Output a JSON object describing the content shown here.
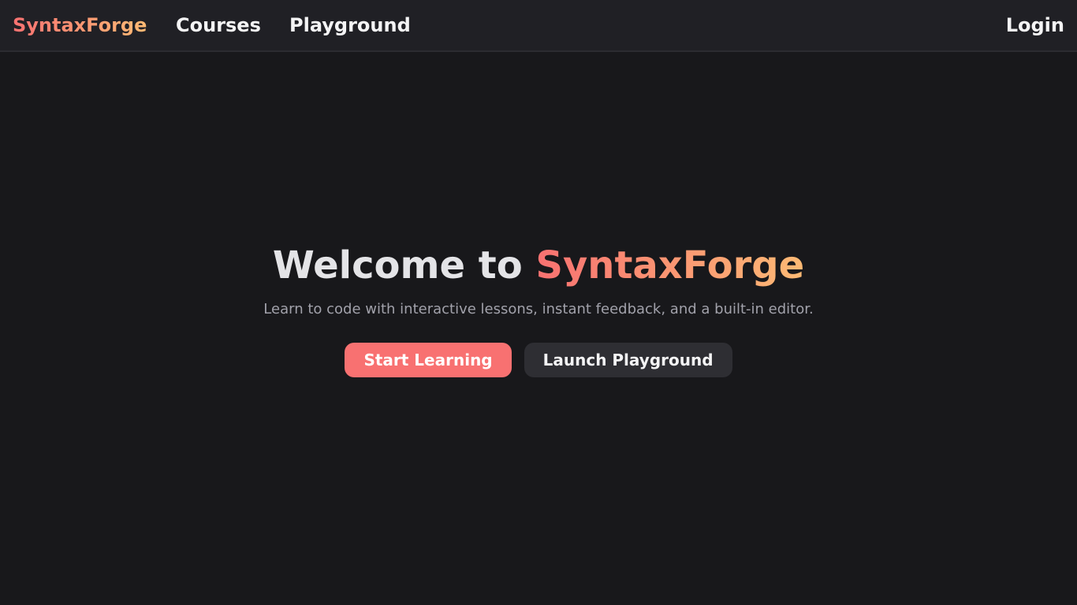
{
  "colors": {
    "background": "#18181b",
    "navbar_background": "#202025",
    "brand_gradient_start": "#f87171",
    "brand_gradient_end": "#fdba74",
    "primary_button": "#f87171",
    "secondary_button": "#2e2e33"
  },
  "nav": {
    "brand": "SyntaxForge",
    "items": [
      {
        "label": "Courses"
      },
      {
        "label": "Playground"
      }
    ],
    "login": "Login"
  },
  "hero": {
    "title_prefix": "Welcome to ",
    "title_accent": "SyntaxForge",
    "subtitle": "Learn to code with interactive lessons, instant feedback, and a built-in editor.",
    "primary_button": "Start Learning",
    "secondary_button": "Launch Playground"
  }
}
